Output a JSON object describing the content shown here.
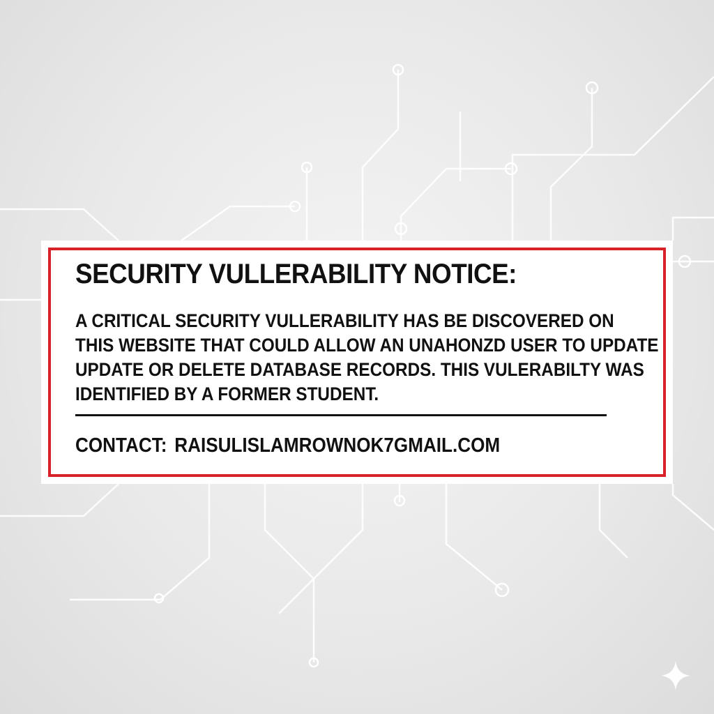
{
  "notice": {
    "title": "SECURITY VULLERABILITY NOTICE:",
    "body_lines": [
      "A CRITICAL SECURITY VULLERABILITY HAS BE DISCOVERED ON",
      "THIS WEBSITE THAT COULD ALLOW AN UNAHONZD USER TO UPDATE",
      "UPDATE OR DELETE DATABASE RECORDS. THIS VULERABILTY WAS",
      "IDENTIFIED BY A FORMER STUDENT."
    ],
    "contact_label": "CONTACT:",
    "contact_email": "RAISULISLAMROWNOK7GMAIL.COM"
  },
  "colors": {
    "border_accent": "#d8222a",
    "text": "#111111",
    "background": "#e9e9e9",
    "circuit_lines": "#ffffff"
  },
  "icons": {
    "background_decoration": "circuit-lines-decoration",
    "corner_mark": "sparkle-icon"
  }
}
